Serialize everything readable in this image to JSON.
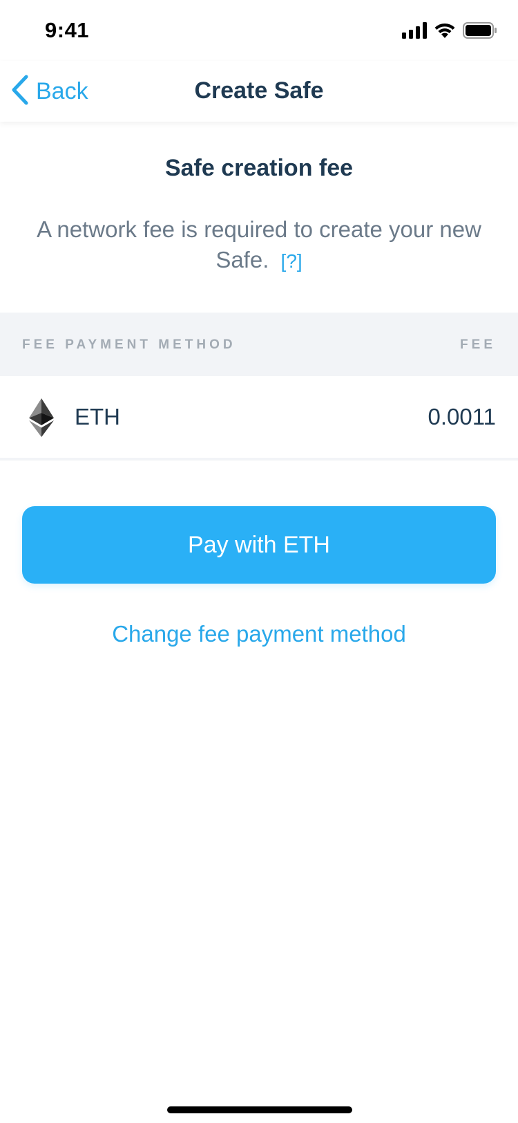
{
  "status_bar": {
    "time": "9:41",
    "icons": [
      "cellular-signal-icon",
      "wifi-icon",
      "battery-icon"
    ]
  },
  "nav": {
    "back_label": "Back",
    "title": "Create Safe"
  },
  "content": {
    "section_title": "Safe creation fee",
    "description": "A network fee is required to create your new Safe.",
    "help_link": "[?]"
  },
  "fee_table": {
    "header_method": "FEE PAYMENT METHOD",
    "header_fee": "FEE",
    "rows": [
      {
        "token": "ETH",
        "fee": "0.0011",
        "icon": "ethereum-icon"
      }
    ]
  },
  "actions": {
    "pay_label": "Pay with ETH",
    "change_method_label": "Change fee payment method"
  },
  "colors": {
    "accent": "#29a8ea",
    "button": "#2ab0f6",
    "title_text": "#1f3a52",
    "body_text": "#6b7a89",
    "header_bg": "#f2f4f7",
    "header_text": "#a3abb4"
  }
}
